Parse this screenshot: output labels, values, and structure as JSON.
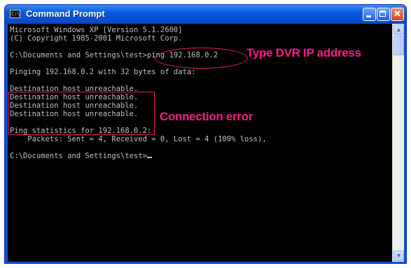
{
  "window": {
    "title": "Command Prompt",
    "icon_text": "C:\\"
  },
  "controls": {
    "minimize": "minimize-icon",
    "maximize": "maximize-icon",
    "close_glyph": "✕"
  },
  "console": {
    "lines": [
      "Microsoft Windows XP [Version 5.1.2600]",
      "(C) Copyright 1985-2001 Microsoft Corp.",
      "C:\\Documents and Settings\\test>ping 192.168.0.2",
      "Pinging 192.168.0.2 with 32 bytes of data:",
      "Destination host unreachable.",
      "Destination host unreachable.",
      "Destination host unreachable.",
      "Destination host unreachable.",
      "Ping statistics for 192.168.0.2:",
      "    Packets: Sent = 4, Received = 0, Lost = 4 (100% loss),",
      "C:\\Documents and Settings\\test>"
    ]
  },
  "annotations": {
    "ip_label": "Type DVR  IP address",
    "error_label": "Connection error",
    "color": "#ff1a8c"
  },
  "colors": {
    "title_bar": "#0a58e0",
    "console_bg": "#000000",
    "console_text": "#c0c0c0"
  }
}
